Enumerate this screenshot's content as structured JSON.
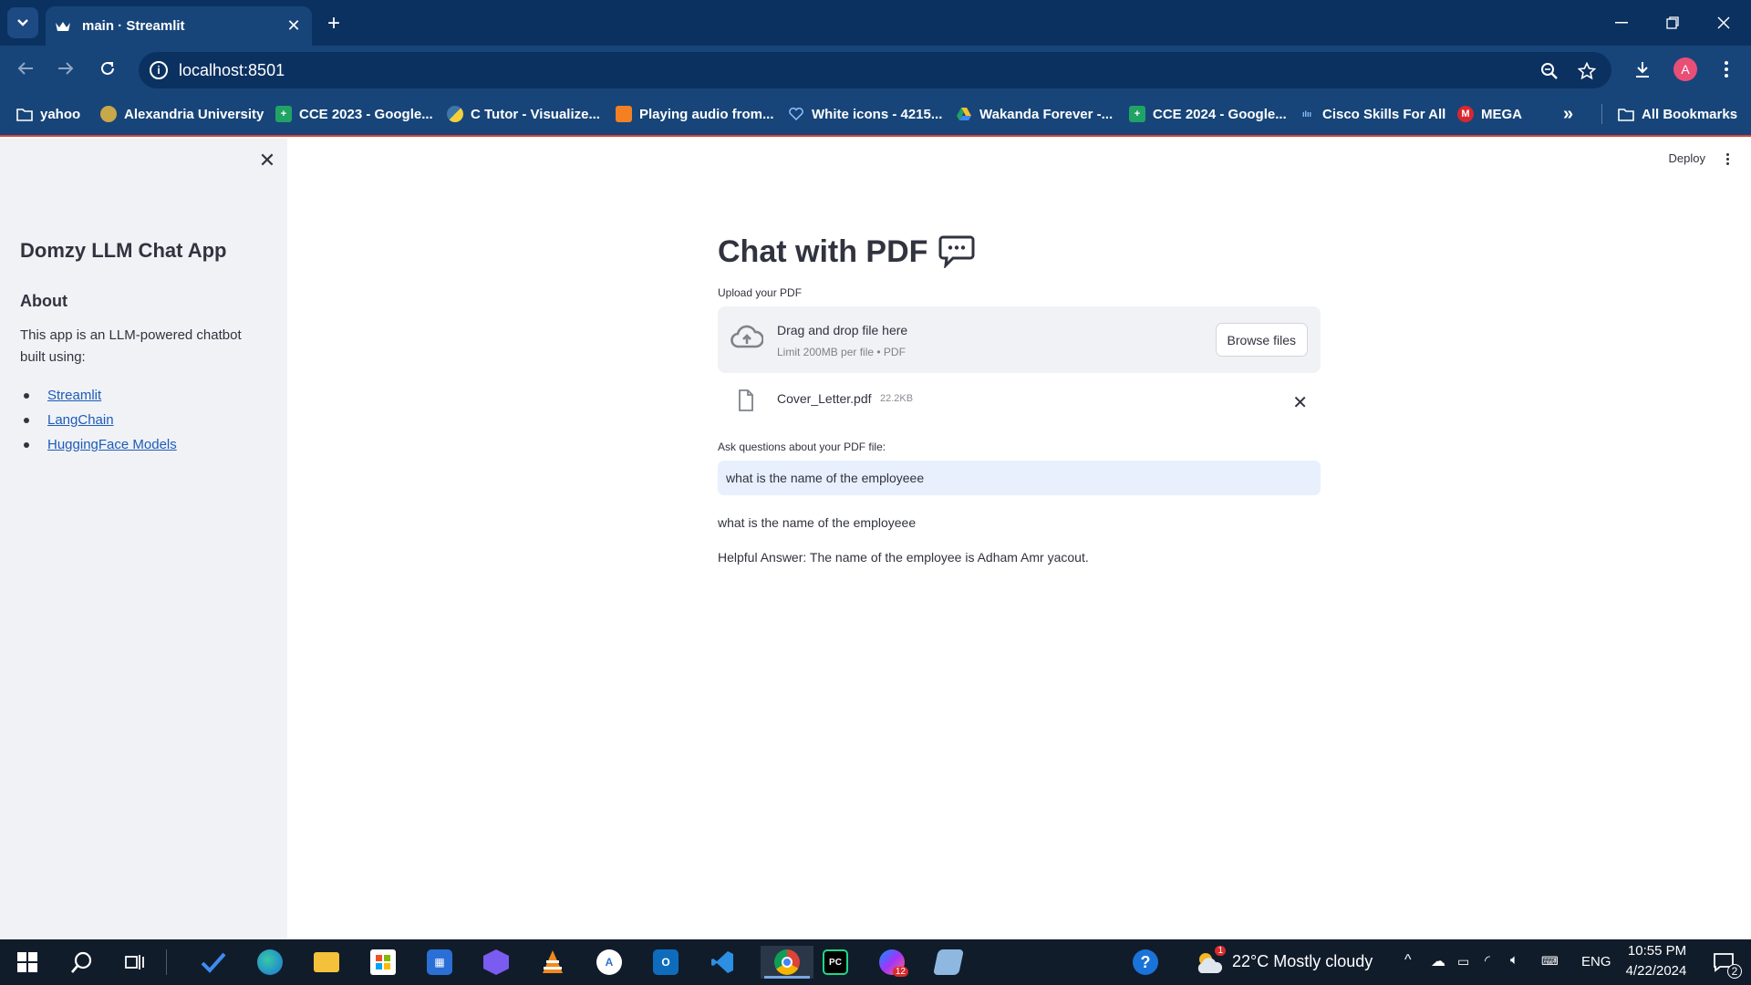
{
  "browser": {
    "tab_title": "main · Streamlit",
    "url": "localhost:8501",
    "profile_initial": "A",
    "bookmarks": [
      "yahoo",
      "Alexandria University",
      "CCE 2023 - Google...",
      "C Tutor - Visualize...",
      "Playing audio from...",
      "White icons - 4215...",
      "Wakanda Forever -...",
      "CCE 2024 - Google...",
      "Cisco Skills For All",
      "MEGA"
    ],
    "all_bookmarks_label": "All Bookmarks"
  },
  "app": {
    "deploy_label": "Deploy",
    "sidebar": {
      "title": "Domzy LLM Chat App",
      "about_heading": "About",
      "about_text": "This app is an LLM-powered chatbot built using:",
      "links": [
        "Streamlit",
        "LangChain",
        "HuggingFace Models"
      ]
    },
    "main": {
      "title": "Chat with PDF",
      "upload_label": "Upload your PDF",
      "dropzone_text": "Drag and drop file here",
      "dropzone_limit": "Limit 200MB per file • PDF",
      "browse_label": "Browse files",
      "file_name": "Cover_Letter.pdf",
      "file_size": "22.2KB",
      "question_label": "Ask questions about your PDF file:",
      "question_value": "what is the name of the employeee",
      "echo_question": "what is the name of the employeee",
      "answer": "Helpful Answer: The name of the employee is Adham Amr yacout."
    }
  },
  "taskbar": {
    "weather": "22°C  Mostly cloudy",
    "language": "ENG",
    "time": "10:55 PM",
    "date": "4/22/2024",
    "notification_count": "2",
    "weather_badge": "1",
    "app_badge": "12"
  }
}
